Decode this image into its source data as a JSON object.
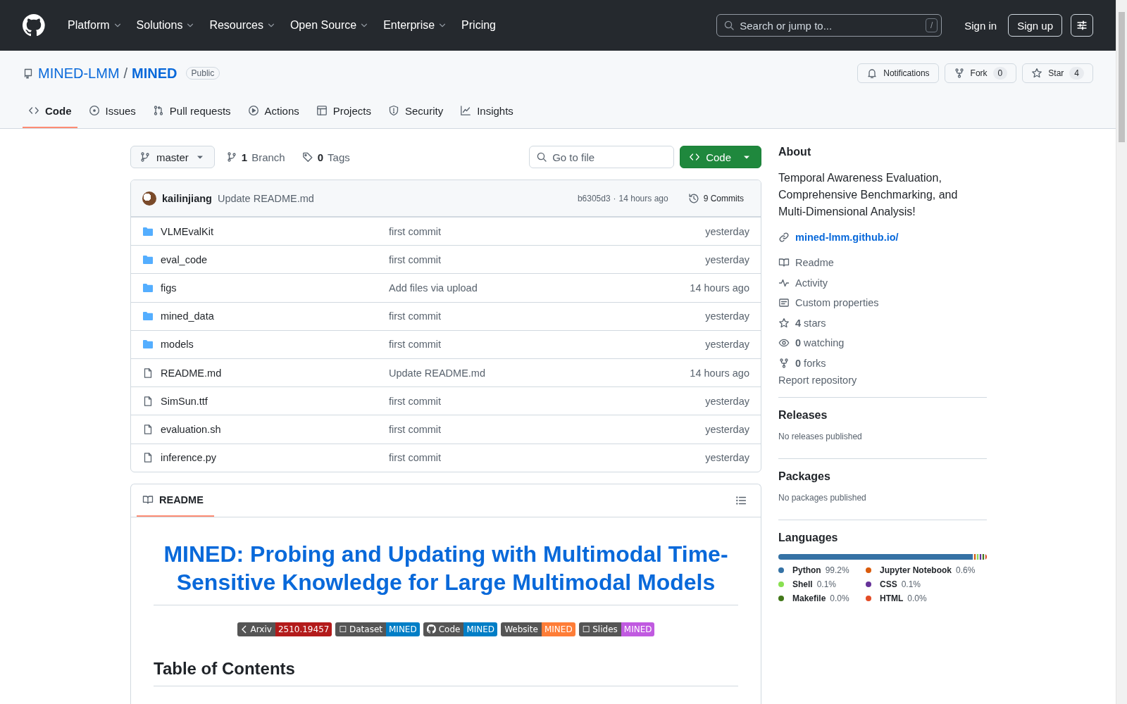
{
  "nav": {
    "items": [
      {
        "label": "Platform",
        "dropdown": true
      },
      {
        "label": "Solutions",
        "dropdown": true
      },
      {
        "label": "Resources",
        "dropdown": true
      },
      {
        "label": "Open Source",
        "dropdown": true
      },
      {
        "label": "Enterprise",
        "dropdown": true
      },
      {
        "label": "Pricing",
        "dropdown": false
      }
    ],
    "search": {
      "placeholder": "Search or jump to...",
      "shortcut": "/"
    },
    "sign_in": "Sign in",
    "sign_up": "Sign up"
  },
  "repo": {
    "owner": "MINED-LMM",
    "separator": "/",
    "name": "MINED",
    "visibility": "Public",
    "actions": [
      {
        "kind": "notifications",
        "label": "Notifications"
      },
      {
        "kind": "fork",
        "label": "Fork",
        "count": "0"
      },
      {
        "kind": "star",
        "label": "Star",
        "count": "4"
      }
    ]
  },
  "tabs": [
    {
      "kind": "code",
      "label": "Code",
      "selected": true
    },
    {
      "kind": "issues",
      "label": "Issues",
      "selected": false
    },
    {
      "kind": "pulls",
      "label": "Pull requests",
      "selected": false
    },
    {
      "kind": "actions",
      "label": "Actions",
      "selected": false
    },
    {
      "kind": "projects",
      "label": "Projects",
      "selected": false
    },
    {
      "kind": "security",
      "label": "Security",
      "selected": false
    },
    {
      "kind": "insights",
      "label": "Insights",
      "selected": false
    }
  ],
  "toolbar": {
    "branch": "master",
    "branch_count": "1",
    "branch_label": "Branch",
    "tag_count": "0",
    "tag_label": "Tags",
    "go_to_file": {
      "placeholder": "Go to file"
    },
    "code_button": "Code"
  },
  "commit": {
    "author": "kailinjiang",
    "message": "Update README.md",
    "hash": "b6305d3",
    "separator": "·",
    "time": "14 hours ago",
    "commits": "9 Commits"
  },
  "files": [
    {
      "kind": "folder",
      "name": "VLMEvalKit",
      "message": "first commit",
      "time": "yesterday"
    },
    {
      "kind": "folder",
      "name": "eval_code",
      "message": "first commit",
      "time": "yesterday"
    },
    {
      "kind": "folder",
      "name": "figs",
      "message": "Add files via upload",
      "time": "14 hours ago"
    },
    {
      "kind": "folder",
      "name": "mined_data",
      "message": "first commit",
      "time": "yesterday"
    },
    {
      "kind": "folder",
      "name": "models",
      "message": "first commit",
      "time": "yesterday"
    },
    {
      "kind": "file",
      "name": "README.md",
      "message": "Update README.md",
      "time": "14 hours ago"
    },
    {
      "kind": "file",
      "name": "SimSun.ttf",
      "message": "first commit",
      "time": "yesterday"
    },
    {
      "kind": "file",
      "name": "evaluation.sh",
      "message": "first commit",
      "time": "yesterday"
    },
    {
      "kind": "file",
      "name": "inference.py",
      "message": "first commit",
      "time": "yesterday"
    }
  ],
  "readme": {
    "tab": "README",
    "title": "MINED: Probing and Updating with Multimodal Time-Sensitive Knowledge for Large Multimodal Models",
    "badges": [
      {
        "kind": "arxiv",
        "label": "Arxiv",
        "value": "2510.19457",
        "color": "#b31b1b"
      },
      {
        "kind": "box",
        "label": "☐ Dataset",
        "value": "MINED",
        "color": "#007ec6"
      },
      {
        "kind": "github",
        "label": "Code",
        "value": "MINED",
        "color": "#007ec6"
      },
      {
        "kind": "plain",
        "label": "Website",
        "value": "MINED",
        "color": "#fe7d37"
      },
      {
        "kind": "box",
        "label": "☐ Slides",
        "value": "MINED",
        "color": "#c05ae0"
      }
    ],
    "heading": "Table of Contents"
  },
  "about": {
    "title": "About",
    "description": "Temporal Awareness Evaluation, Comprehensive Benchmarking, and Multi-Dimensional Analysis!",
    "link": "mined-lmm.github.io/",
    "items": [
      {
        "kind": "readme",
        "label": "Readme"
      },
      {
        "kind": "activity",
        "label": "Activity"
      },
      {
        "kind": "properties",
        "label": "Custom properties"
      },
      {
        "kind": "stars",
        "count": "4",
        "label": "stars"
      },
      {
        "kind": "watching",
        "count": "0",
        "label": "watching"
      },
      {
        "kind": "forks",
        "count": "0",
        "label": "forks"
      }
    ],
    "report": "Report repository"
  },
  "releases": {
    "title": "Releases",
    "note": "No releases published"
  },
  "packages": {
    "title": "Packages",
    "note": "No packages published"
  },
  "languages": {
    "title": "Languages",
    "items": [
      {
        "name": "Python",
        "percent": "99.2%",
        "color": "#3572a5"
      },
      {
        "name": "Jupyter Notebook",
        "percent": "0.6%",
        "color": "#da5b0b"
      },
      {
        "name": "Shell",
        "percent": "0.1%",
        "color": "#89e051"
      },
      {
        "name": "CSS",
        "percent": "0.1%",
        "color": "#663399"
      },
      {
        "name": "Makefile",
        "percent": "0.0%",
        "color": "#427819"
      },
      {
        "name": "HTML",
        "percent": "0.0%",
        "color": "#e34c26"
      }
    ]
  }
}
